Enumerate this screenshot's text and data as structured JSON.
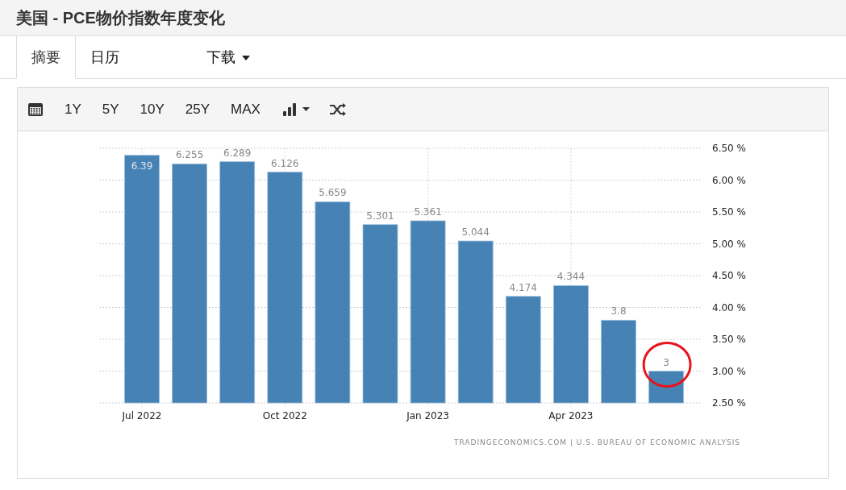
{
  "title": "美国 - PCE物价指数年度变化",
  "tabs": [
    {
      "label": "摘要",
      "selected": true,
      "kind": "plain"
    },
    {
      "label": "日历",
      "selected": false,
      "kind": "plain"
    },
    {
      "label": "下载",
      "selected": false,
      "kind": "dropdown"
    }
  ],
  "toolbar": {
    "ranges": [
      "1Y",
      "5Y",
      "10Y",
      "25Y",
      "MAX"
    ]
  },
  "chart": {
    "chart_data": {
      "type": "bar",
      "categories": [
        "Jul 2022",
        null,
        null,
        "Oct 2022",
        null,
        null,
        "Jan 2023",
        null,
        null,
        "Apr 2023",
        null,
        null
      ],
      "series": [
        {
          "color": "#4682b4",
          "values": [
            6.39,
            6.255,
            6.289,
            6.126,
            5.659,
            5.301,
            5.361,
            5.044,
            4.174,
            4.344,
            3.8,
            3
          ]
        }
      ],
      "ylim": [
        2.5,
        6.5
      ],
      "yticks": [
        {
          "value": 6.5,
          "label": "6.50 %"
        },
        {
          "value": 6,
          "label": "6.00 %"
        },
        {
          "value": 5.5,
          "label": "5.50 %"
        },
        {
          "value": 5,
          "label": "5.00 %"
        },
        {
          "value": 4.5,
          "label": "4.50 %"
        },
        {
          "value": 4,
          "label": "4.00 %"
        },
        {
          "value": 3.5,
          "label": "3.50 %"
        },
        {
          "value": 3,
          "label": "3.00 %"
        },
        {
          "value": 2.5,
          "label": "2.50 %"
        }
      ],
      "value_labels": [
        "6.39",
        "6.255",
        "6.289",
        "6.126",
        "5.659",
        "5.301",
        "5.361",
        "5.044",
        "4.174",
        "4.344",
        "3.8",
        "3"
      ],
      "grid": true
    },
    "last_bar_circled": true,
    "source": "TRADINGECONOMICS.COM | U.S. BUREAU OF ECONOMIC ANALYSIS"
  }
}
